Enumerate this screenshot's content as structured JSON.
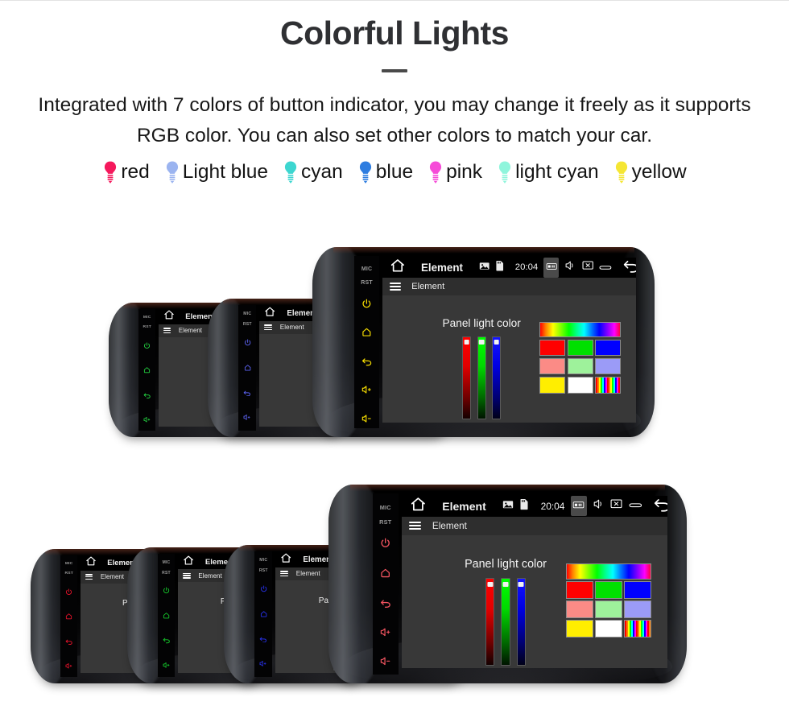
{
  "header": {
    "title": "Colorful Lights",
    "description": "Integrated with 7 colors of button indicator, you may change it freely as it supports RGB color. You can also set other colors to match your car."
  },
  "legend": {
    "items": [
      {
        "label": "red",
        "icon": "bulb-icon",
        "color": "#F5185C"
      },
      {
        "label": "Light blue",
        "icon": "bulb-icon",
        "color": "#9BB4F0"
      },
      {
        "label": "cyan",
        "icon": "bulb-icon",
        "color": "#3DD6D0"
      },
      {
        "label": "blue",
        "icon": "bulb-icon",
        "color": "#2E7DE0"
      },
      {
        "label": "pink",
        "icon": "bulb-icon",
        "color": "#F64BD8"
      },
      {
        "label": "light cyan",
        "icon": "bulb-icon",
        "color": "#8FF5DC"
      },
      {
        "label": "yellow",
        "icon": "bulb-icon",
        "color": "#F5E633"
      }
    ]
  },
  "device_ui": {
    "bezel": {
      "mic_label": "MIC",
      "reset_label": "RST",
      "buttons": [
        {
          "name": "power-button",
          "icon": "power-icon"
        },
        {
          "name": "home-button",
          "icon": "home-icon"
        },
        {
          "name": "back-button",
          "icon": "back-arrow-icon"
        },
        {
          "name": "volume-up-button",
          "icon": "volume-up-icon"
        },
        {
          "name": "volume-down-button",
          "icon": "volume-down-icon"
        }
      ]
    },
    "statusbar": {
      "home_icon": "home-icon",
      "title": "Element",
      "left_icons": [
        "image-icon",
        "sdcard-icon"
      ],
      "time": "20:04",
      "right_icons": [
        "screenshot-icon",
        "mute-speaker-icon",
        "close-window-icon",
        "recent-apps-icon",
        "back-arrow-icon"
      ]
    },
    "appbar": {
      "menu_icon": "hamburger-menu-icon",
      "title": "Element"
    },
    "panel": {
      "label": "Panel light color",
      "sliders": [
        {
          "name": "red-slider",
          "value": 100
        },
        {
          "name": "green-slider",
          "value": 100
        },
        {
          "name": "blue-slider",
          "value": 100
        }
      ],
      "swatches": {
        "gradient_bar": "rainbow-gradient",
        "rows": [
          [
            {
              "name": "swatch-red",
              "color": "#FF0000"
            },
            {
              "name": "swatch-green",
              "color": "#00E000"
            },
            {
              "name": "swatch-blue",
              "color": "#0000FF"
            }
          ],
          [
            {
              "name": "swatch-salmon",
              "color": "#FB8B86"
            },
            {
              "name": "swatch-light-green",
              "color": "#9EF29B"
            },
            {
              "name": "swatch-periwinkle",
              "color": "#9B9BF7"
            }
          ],
          [
            {
              "name": "swatch-yellow",
              "color": "#FFEE00"
            },
            {
              "name": "swatch-white",
              "color": "#FFFFFF"
            },
            {
              "name": "swatch-rainbow",
              "color": "rainbow-stripes"
            }
          ]
        ]
      }
    }
  },
  "rows": [
    {
      "name": "top-row",
      "devices": [
        {
          "name": "device-green",
          "accent": "#24D441",
          "show_panel": false,
          "show_right_status": false
        },
        {
          "name": "device-indigo",
          "accent": "#5B62F0",
          "show_panel": false,
          "show_right_status": false
        },
        {
          "name": "device-yellow",
          "accent": "#F2D900",
          "show_panel": true,
          "show_right_status": true
        }
      ]
    },
    {
      "name": "bottom-row",
      "devices": [
        {
          "name": "device-red",
          "accent": "#E8122B",
          "show_panel": true,
          "show_right_status": false
        },
        {
          "name": "device-green2",
          "accent": "#15C92B",
          "show_panel": true,
          "show_right_status": false
        },
        {
          "name": "device-blue",
          "accent": "#2731E8",
          "show_panel": true,
          "show_right_status": false
        },
        {
          "name": "device-salmon",
          "accent": "#F0535F",
          "show_panel": true,
          "show_right_status": true
        }
      ]
    }
  ]
}
